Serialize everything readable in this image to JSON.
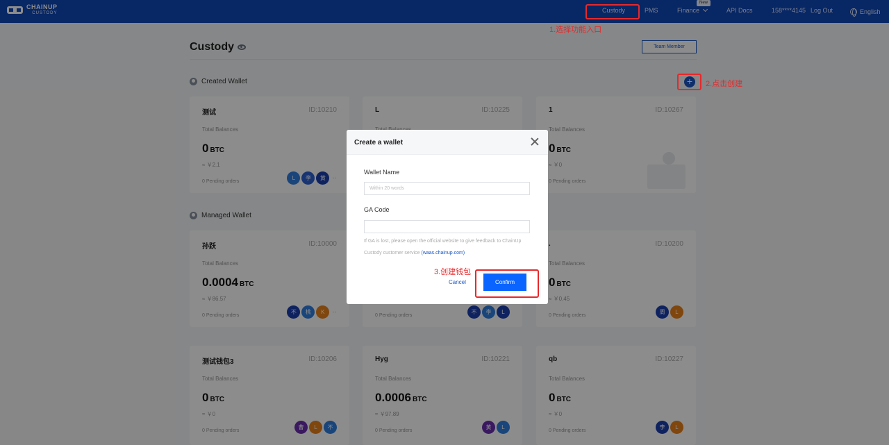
{
  "nav": {
    "logo_line1": "CHAINUP",
    "logo_line2": "CUSTODY",
    "custody": "Custody",
    "pms": "PMS",
    "finance": "Finance",
    "new_badge": "New",
    "api_docs": "API Docs",
    "phone": "158****4145",
    "logout": "Log Out",
    "language": "English"
  },
  "annotations": {
    "step1": "1.选择功能入口",
    "step2": "2.点击创建",
    "step3": "3.创建钱包",
    "color": "#e8282a"
  },
  "page": {
    "title": "Custody",
    "team_member_button": "Team Member",
    "created_wallet_title": "Created Wallet",
    "managed_wallet_title": "Managed Wallet",
    "add_button": "+"
  },
  "cards": [
    {
      "name": "测试",
      "id": "ID:10210",
      "label": "Total Balances",
      "amount": "0",
      "unit": "BTC",
      "approx": "≈ ￥2.1",
      "pending": "0 Pending orders",
      "avatars": [
        {
          "t": "L",
          "c": "#2f7fe0"
        },
        {
          "t": "李",
          "c": "#2f5fd0"
        },
        {
          "t": "黄",
          "c": "#1b3fb0"
        }
      ],
      "more": "··"
    },
    {
      "name": "L",
      "id": "ID:10225",
      "label": "Total Balances",
      "amount": "",
      "unit": "",
      "approx": "",
      "pending": "",
      "avatars": [],
      "more": ""
    },
    {
      "name": "1",
      "id": "ID:10267",
      "label": "Total Balances",
      "amount": "0",
      "unit": "BTC",
      "approx": "≈ ￥0",
      "pending": "0 Pending orders",
      "avatars": [],
      "more": ""
    },
    {
      "name": "孙跃",
      "id": "ID:10000",
      "label": "Total Balances",
      "amount": "0.0004",
      "unit": "BTC",
      "approx": "≈ ￥86.57",
      "pending": "0 Pending orders",
      "avatars": [
        {
          "t": "不",
          "c": "#1b3fb0"
        },
        {
          "t": "桃",
          "c": "#2f7fe0"
        },
        {
          "t": "K",
          "c": "#e8801a"
        }
      ],
      "more": "··"
    },
    {
      "name": "",
      "id": "",
      "label": "",
      "amount": "",
      "unit": "",
      "approx": "",
      "pending": "0 Pending orders",
      "avatars": [
        {
          "t": "不",
          "c": "#1b3fb0"
        },
        {
          "t": "李",
          "c": "#2f7fe0"
        },
        {
          "t": "L",
          "c": "#1b3fb0"
        }
      ],
      "more": ""
    },
    {
      "name": ".",
      "id": "ID:10200",
      "label": "Total Balances",
      "amount": "0",
      "unit": "BTC",
      "approx": "≈ ￥0.45",
      "pending": "0 Pending orders",
      "avatars": [
        {
          "t": "周",
          "c": "#1b3fb0"
        },
        {
          "t": "L",
          "c": "#e8801a"
        }
      ],
      "more": ""
    },
    {
      "name": "测试钱包3",
      "id": "ID:10206",
      "label": "Total Balances",
      "amount": "0",
      "unit": "BTC",
      "approx": "≈ ￥0",
      "pending": "0 Pending orders",
      "avatars": [
        {
          "t": "曹",
          "c": "#6a2fb0"
        },
        {
          "t": "L",
          "c": "#e8801a"
        },
        {
          "t": "不",
          "c": "#2f7fe0"
        }
      ],
      "more": ""
    },
    {
      "name": "Hyg",
      "id": "ID:10221",
      "label": "Total Balances",
      "amount": "0.0006",
      "unit": "BTC",
      "approx": "≈ ￥97.89",
      "pending": "0 Pending orders",
      "avatars": [
        {
          "t": "黄",
          "c": "#6a2fb0"
        },
        {
          "t": "L",
          "c": "#2f7fe0"
        }
      ],
      "more": ""
    },
    {
      "name": "qb",
      "id": "ID:10227",
      "label": "Total Balances",
      "amount": "0",
      "unit": "BTC",
      "approx": "≈ ￥0",
      "pending": "0 Pending orders",
      "avatars": [
        {
          "t": "李",
          "c": "#1b3fb0"
        },
        {
          "t": "L",
          "c": "#e8801a"
        }
      ],
      "more": ""
    }
  ],
  "modal": {
    "title": "Create a wallet",
    "wallet_name_label": "Wallet Name",
    "wallet_name_placeholder": "Within 20 words",
    "wallet_name_value": "",
    "ga_code_label": "GA Code",
    "ga_code_value": "",
    "hint_text": "If GA is lost, please open the official website to give feedback to ChainUp Custody customer service",
    "hint_link": "(waas.chainup.com)",
    "cancel_label": "Cancel",
    "confirm_label": "Confirm"
  }
}
